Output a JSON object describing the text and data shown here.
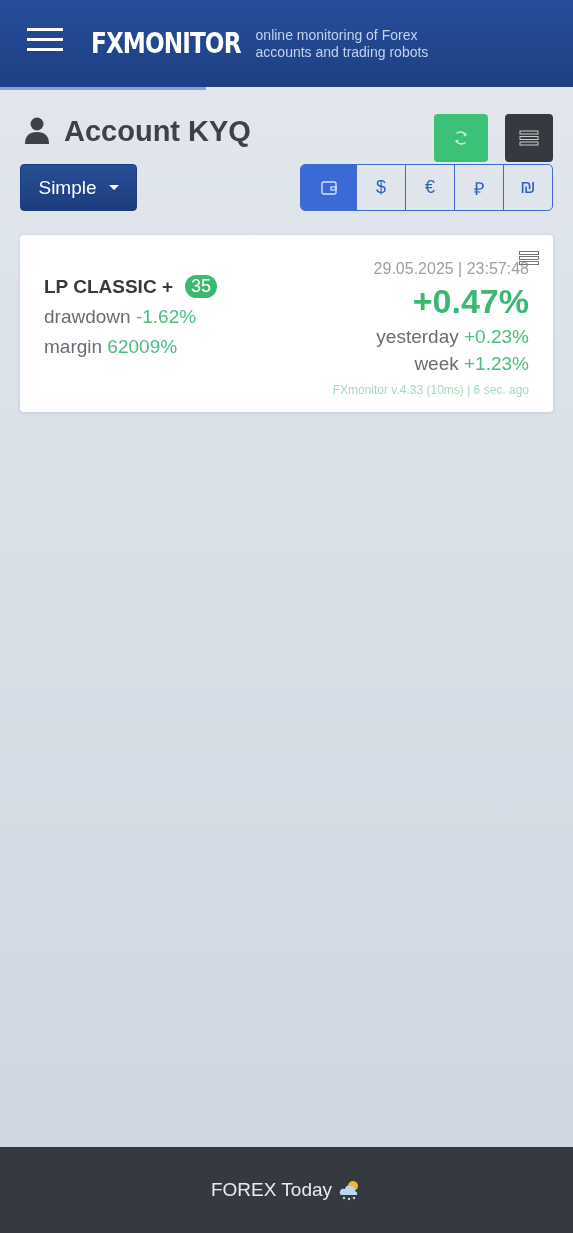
{
  "header": {
    "logo": "FXMONITOR",
    "tagline": "online monitoring of Forex accounts and trading robots",
    "progress": {
      "level": 0.36
    }
  },
  "account": {
    "title": "Account KYQ"
  },
  "mode_dropdown": {
    "value": "Simple"
  },
  "currencies": [
    {
      "kind": "wallet",
      "selected": true
    },
    {
      "kind": "text",
      "label": "$",
      "selected": false
    },
    {
      "kind": "text",
      "label": "€",
      "selected": false
    },
    {
      "kind": "text",
      "label": "₽",
      "selected": false
    },
    {
      "kind": "text",
      "label": "₪",
      "selected": false
    }
  ],
  "card": {
    "name": "LP CLASSIC +",
    "badge": "35",
    "stats": [
      {
        "label": "drawdown",
        "value": "-1.62%"
      },
      {
        "label": "margin",
        "value": "62009%"
      }
    ],
    "timestamp": "29.05.2025 | 23:57:48",
    "profit": "+0.47%",
    "periods": [
      {
        "label": "yesterday",
        "value": "+0.23%"
      },
      {
        "label": "week",
        "value": "+1.23%"
      }
    ],
    "footer": "FXmonitor v.4.33 (10ms) | 6 sec. ago"
  },
  "bottom_bar": {
    "label": "FOREX Today"
  }
}
